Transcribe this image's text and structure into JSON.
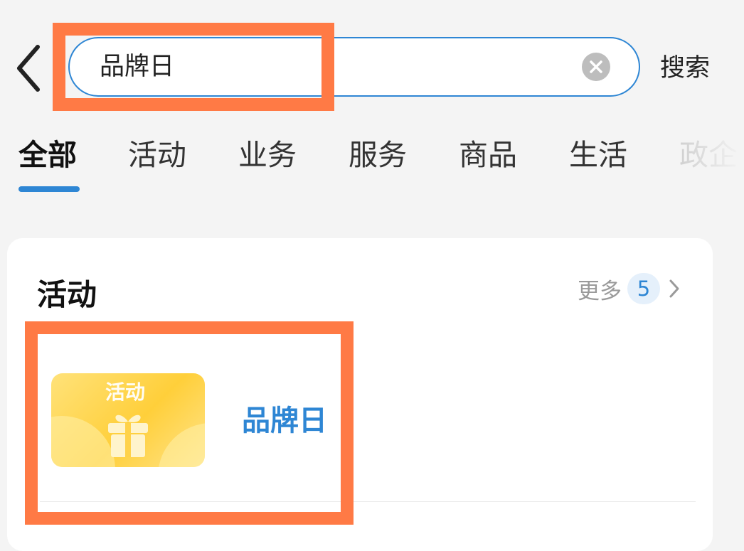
{
  "header": {
    "search_value": "品牌日",
    "search_button_label": "搜索"
  },
  "tabs": [
    {
      "label": "全部"
    },
    {
      "label": "活动"
    },
    {
      "label": "业务"
    },
    {
      "label": "服务"
    },
    {
      "label": "商品"
    },
    {
      "label": "生活"
    },
    {
      "label": "政企"
    }
  ],
  "section": {
    "title": "活动",
    "more_label": "更多",
    "more_count": "5",
    "items": [
      {
        "thumb_tag": "活动",
        "title": "品牌日"
      }
    ]
  },
  "colors": {
    "accent": "#2e86d4",
    "highlight": "#ff7a45",
    "thumb": "#ffcf3a"
  },
  "icons": [
    "back-arrow-icon",
    "clear-icon",
    "chevron-right-icon",
    "gift-icon"
  ]
}
